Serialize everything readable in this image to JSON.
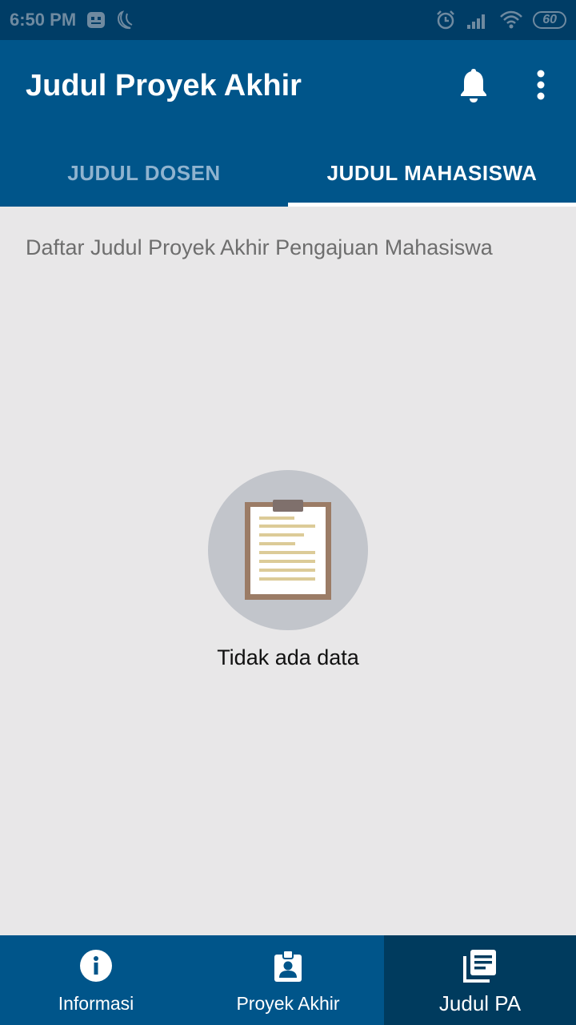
{
  "status_bar": {
    "time": "6:50 PM",
    "battery": "60"
  },
  "app_bar": {
    "title": "Judul Proyek Akhir",
    "tabs": [
      {
        "label": "JUDUL DOSEN",
        "active": false
      },
      {
        "label": "JUDUL MAHASISWA",
        "active": true
      }
    ]
  },
  "content": {
    "subtitle": "Daftar Judul Proyek Akhir Pengajuan Mahasiswa",
    "empty_state": {
      "icon": "clipboard-icon",
      "message": "Tidak ada data"
    }
  },
  "bottom_nav": {
    "items": [
      {
        "label": "Informasi",
        "icon": "info-icon",
        "active": false
      },
      {
        "label": "Proyek Akhir",
        "icon": "id-badge-icon",
        "active": false
      },
      {
        "label": "Judul PA",
        "icon": "library-books-icon",
        "active": true
      }
    ]
  },
  "colors": {
    "primary": "#00558a",
    "primary_dark": "#003d66",
    "nav_active": "#003b5e",
    "background": "#e8e7e8"
  }
}
